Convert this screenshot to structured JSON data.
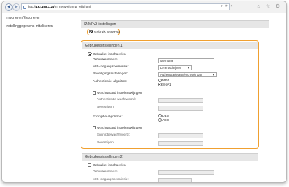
{
  "browser": {
    "address_prefix": "http://",
    "address_host": "192.168.1.24",
    "address_path": "/m_netsvs/snmp_edit.html",
    "addr_controls": "▾ ⟳ ×",
    "toolbar_icons": "⌂ ☆ ⚙"
  },
  "nav": {
    "items": [
      {
        "label": "Importeren/Exporteren"
      },
      {
        "label": "Instellinggegevens initialiseren"
      }
    ]
  },
  "snmpv3": {
    "header": "SNMPv3-instellingen",
    "use_label": "Gebruik SNMPv3",
    "use_checked": true
  },
  "user1": {
    "header": "Gebruikersinstellingen 1",
    "enable_label": "Gebruiker inschakelen",
    "username_label": "Gebruikersnaam:",
    "username_value": "username",
    "mib_label": "MIB-toegangspermissie:",
    "mib_value": "Lezen/schrijven",
    "security_label": "Beveiligingsinstellingen:",
    "security_value": "Authenticatie aan/encryptie aan",
    "auth_algo_label": "Authenticatie-algoritme:",
    "auth_opt_md5": "MD5",
    "auth_opt_sha1": "SHA1",
    "set_auth_pw_label": "Wachtwoord instellen/wijzigen",
    "auth_pw_label": "Authenticatie wachtwoord:",
    "confirm_label": "Bevestigen:",
    "enc_algo_label": "Encryptie-algoritme:",
    "enc_opt_des": "DES",
    "enc_opt_aes": "AES",
    "set_enc_pw_label": "Wachtwoord instellen/wijzigen",
    "enc_pw_label": "Encryptiewachtwoord:",
    "confirm2_label": "Bevestigen:"
  },
  "user2": {
    "header": "Gebruikersinstellingen 2",
    "enable_label": "Gebruiker inschakelen",
    "username_label": "Gebruikersnaam:",
    "mib_label": "MIB-toegangspermissie:"
  }
}
